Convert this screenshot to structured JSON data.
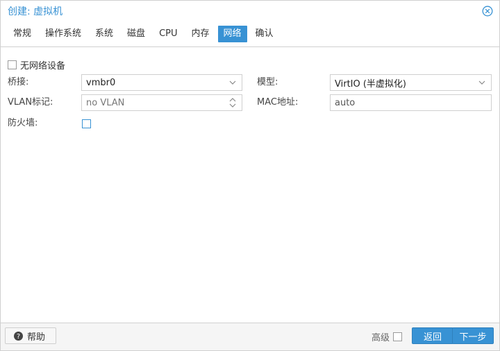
{
  "dialog": {
    "title": "创建: 虚拟机"
  },
  "tabs": [
    {
      "label": "常规"
    },
    {
      "label": "操作系统"
    },
    {
      "label": "系统"
    },
    {
      "label": "磁盘"
    },
    {
      "label": "CPU"
    },
    {
      "label": "内存"
    },
    {
      "label": "网络",
      "active": true
    },
    {
      "label": "确认"
    }
  ],
  "network": {
    "no_network_label": "无网络设备",
    "bridge_label": "桥接:",
    "bridge_value": "vmbr0",
    "vlan_label": "VLAN标记:",
    "vlan_value": "no VLAN",
    "firewall_label": "防火墙:",
    "model_label": "模型:",
    "model_value": "VirtIO (半虚拟化)",
    "mac_label": "MAC地址:",
    "mac_value": "auto"
  },
  "footer": {
    "help_label": "帮助",
    "advanced_label": "高级",
    "back_label": "返回",
    "next_label": "下一步"
  },
  "colors": {
    "accent": "#3892d4",
    "border": "#cfcfcf",
    "footer_bg": "#f5f5f5"
  }
}
